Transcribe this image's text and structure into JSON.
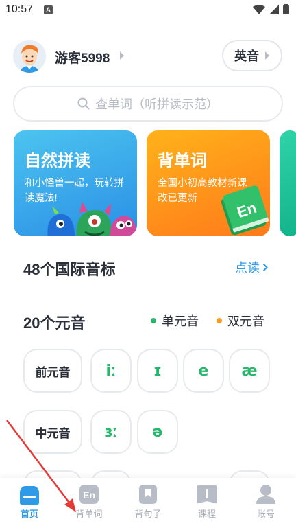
{
  "status_bar": {
    "time": "10:57",
    "notification_badge": "A",
    "icons": [
      "wifi-icon",
      "signal-icon",
      "battery-icon"
    ]
  },
  "header": {
    "username": "游客5998",
    "accent_button": "英音"
  },
  "search": {
    "placeholder": "查单词（听拼读示范）"
  },
  "cards": [
    {
      "title": "自然拼读",
      "subtitle": "和小怪兽一起，玩转拼读魔法!"
    },
    {
      "title": "背单词",
      "subtitle": "全国小初高教材新课改已更新",
      "badge": "En"
    }
  ],
  "sections": {
    "phonetics_title": "48个国际音标",
    "point_read": "点读",
    "vowels_title": "20个元音",
    "legend": [
      {
        "label": "单元音",
        "color": "#25b86b"
      },
      {
        "label": "双元音",
        "color": "#ff9a1a"
      }
    ]
  },
  "vowel_rows": [
    {
      "category": "前元音",
      "phonemes": [
        "iː",
        "ɪ",
        "e",
        "æ"
      ]
    },
    {
      "category": "中元音",
      "phonemes": [
        "ɜː",
        "ə"
      ]
    }
  ],
  "bottom_nav": [
    {
      "label": "首页",
      "icon": "home-icon",
      "active": true
    },
    {
      "label": "背单词",
      "icon": "en-book-icon",
      "active": false
    },
    {
      "label": "背句子",
      "icon": "bookmark-icon",
      "active": false
    },
    {
      "label": "课程",
      "icon": "course-icon",
      "active": false
    },
    {
      "label": "账号",
      "icon": "user-icon",
      "active": false
    }
  ],
  "colors": {
    "primary": "#2f9be8",
    "vowel_green": "#25b86b",
    "annotation_arrow": "#e53935"
  }
}
